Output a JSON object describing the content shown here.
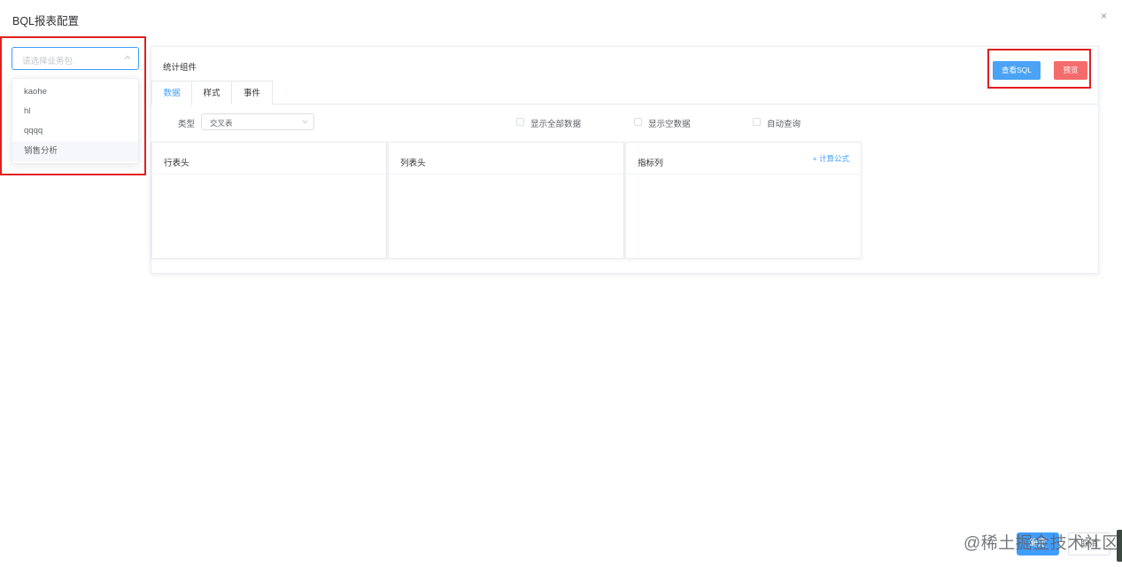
{
  "dialog": {
    "title": "BQL报表配置",
    "close_icon": "×"
  },
  "business_select": {
    "placeholder": "请选择业务包",
    "options": [
      "kaohe",
      "hl",
      "qqqq",
      "销售分析"
    ]
  },
  "panel": {
    "title": "统计组件",
    "view_sql_label": "查看SQL",
    "preview_label": "预览",
    "tabs": [
      "数据",
      "样式",
      "事件"
    ],
    "active_tab": "数据",
    "type_label": "类型",
    "type_value": "交叉表",
    "checkboxes": [
      "显示全部数据",
      "显示空数据",
      "自动查询"
    ],
    "cards": {
      "row_header": "行表头",
      "col_header": "列表头",
      "metric_col": "指标列",
      "formula_link": "+ 计算公式"
    }
  },
  "footer": {
    "ok_label": "确定",
    "cancel_label": "取消"
  },
  "watermark": "@稀土掘金技术社区",
  "colors": {
    "primary": "#409eff",
    "danger": "#f56c6c",
    "highlight_border": "#e0201f"
  }
}
